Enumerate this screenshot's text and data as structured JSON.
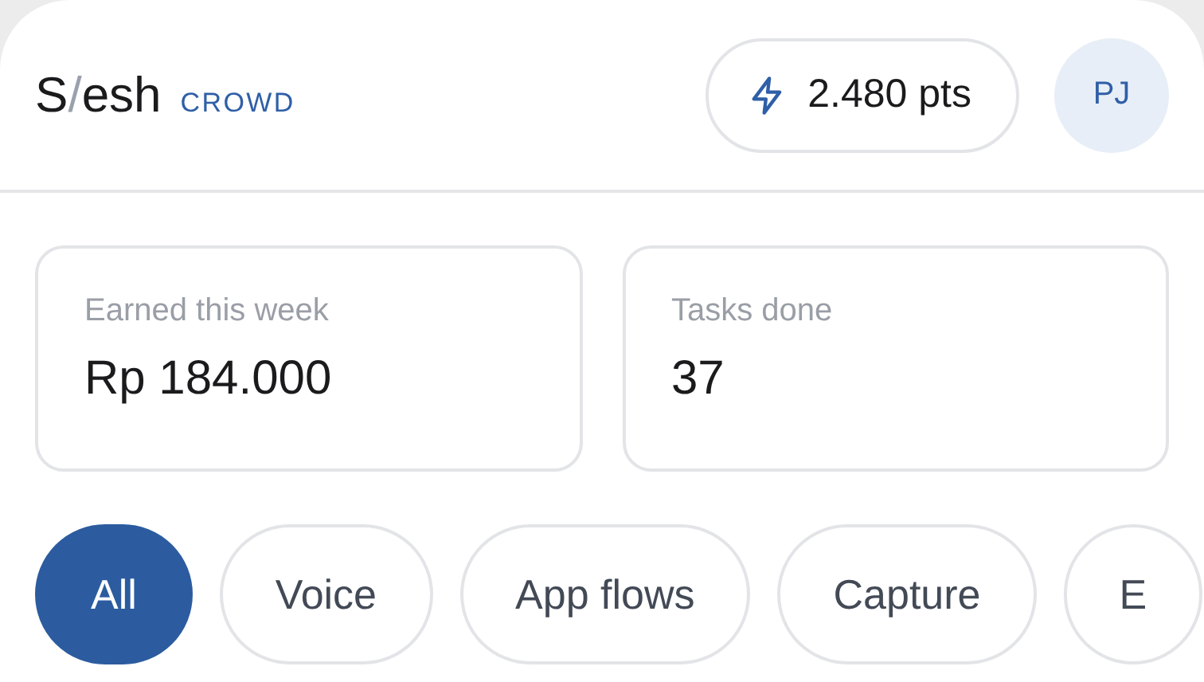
{
  "logo": {
    "lead": "S",
    "mark": "/",
    "rest": "esh"
  },
  "brand_tag": "CROWD",
  "points": "2.480 pts",
  "avatar": "PJ",
  "stats": [
    {
      "label": "Earned this week",
      "value": "Rp 184.000"
    },
    {
      "label": "Tasks done",
      "value": "37"
    }
  ],
  "filters": [
    {
      "label": "All",
      "selected": true
    },
    {
      "label": "Voice",
      "selected": false
    },
    {
      "label": "App flows",
      "selected": false
    },
    {
      "label": "Capture",
      "selected": false
    },
    {
      "label": "E",
      "selected": false
    }
  ]
}
